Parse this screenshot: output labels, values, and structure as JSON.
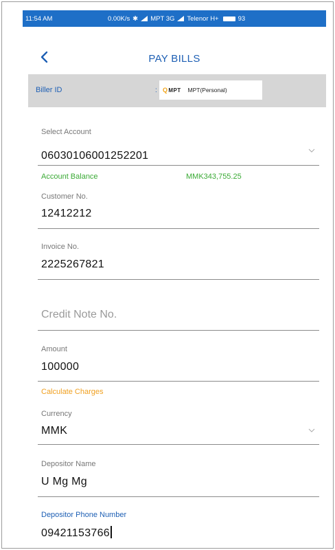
{
  "status_bar": {
    "time": "11:54 AM",
    "net_speed": "0.00K/s",
    "carrier1": "MPT 3G",
    "carrier2": "Telenor H+",
    "battery": "93"
  },
  "header": {
    "title": "PAY BILLS"
  },
  "biller": {
    "label": "Biller ID",
    "colon": ":",
    "logo_text": "MPT",
    "name": "MPT(Personal)"
  },
  "form": {
    "account": {
      "label": "Select Account",
      "value": "06030106001252201"
    },
    "balance": {
      "label": "Account Balance",
      "value": "MMK343,755.25"
    },
    "customer_no": {
      "label": "Customer No.",
      "value": "12412212"
    },
    "invoice_no": {
      "label": "Invoice No.",
      "value": "2225267821"
    },
    "credit_note": {
      "placeholder": "Credit Note No."
    },
    "amount": {
      "label": "Amount",
      "value": "100000"
    },
    "calculate_link": "Calculate Charges",
    "currency": {
      "label": "Currency",
      "value": "MMK"
    },
    "depositor_name": {
      "label": "Depositor Name",
      "value": "U Mg Mg"
    },
    "depositor_phone": {
      "label": "Depositor Phone Number",
      "value": "09421153766"
    }
  },
  "colors": {
    "brand_blue": "#1d5fb4",
    "status_blue": "#1e6fc7",
    "balance_green": "#3aaa35",
    "link_orange": "#f0a020",
    "biller_bg": "#d6d6d6"
  },
  "icons": [
    "back-arrow-icon",
    "chevron-down-icon",
    "signal-icon",
    "battery-icon",
    "bluetooth-icon",
    "mpt-logo-icon"
  ]
}
